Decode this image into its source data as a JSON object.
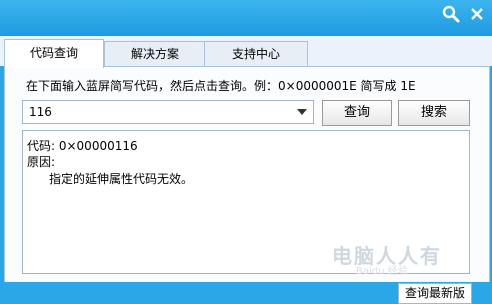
{
  "window": {
    "buttons": {
      "search_icon": "search-icon",
      "close_icon": "close-icon"
    }
  },
  "tabs": [
    {
      "label": "代码查询",
      "active": true
    },
    {
      "label": "解决方案",
      "active": false
    },
    {
      "label": "支持中心",
      "active": false
    }
  ],
  "query": {
    "hint": "在下面输入蓝屏简写代码，然后点击查询。例：0×0000001E 简写成 1E",
    "input_value": "116",
    "query_button": "查询",
    "search_button": "搜索"
  },
  "result": {
    "code_line": "代码: 0×00000116",
    "reason_label": "原因:",
    "reason_text": "指定的延伸属性代码无效。"
  },
  "watermark": {
    "text": "电脑人人有",
    "subtext": "Baidu 经验"
  },
  "footer": {
    "update_button": "查询最新版"
  },
  "colors": {
    "frame": "#2aa7e6",
    "panel": "#fafcfe",
    "border": "#a9c3dc"
  }
}
